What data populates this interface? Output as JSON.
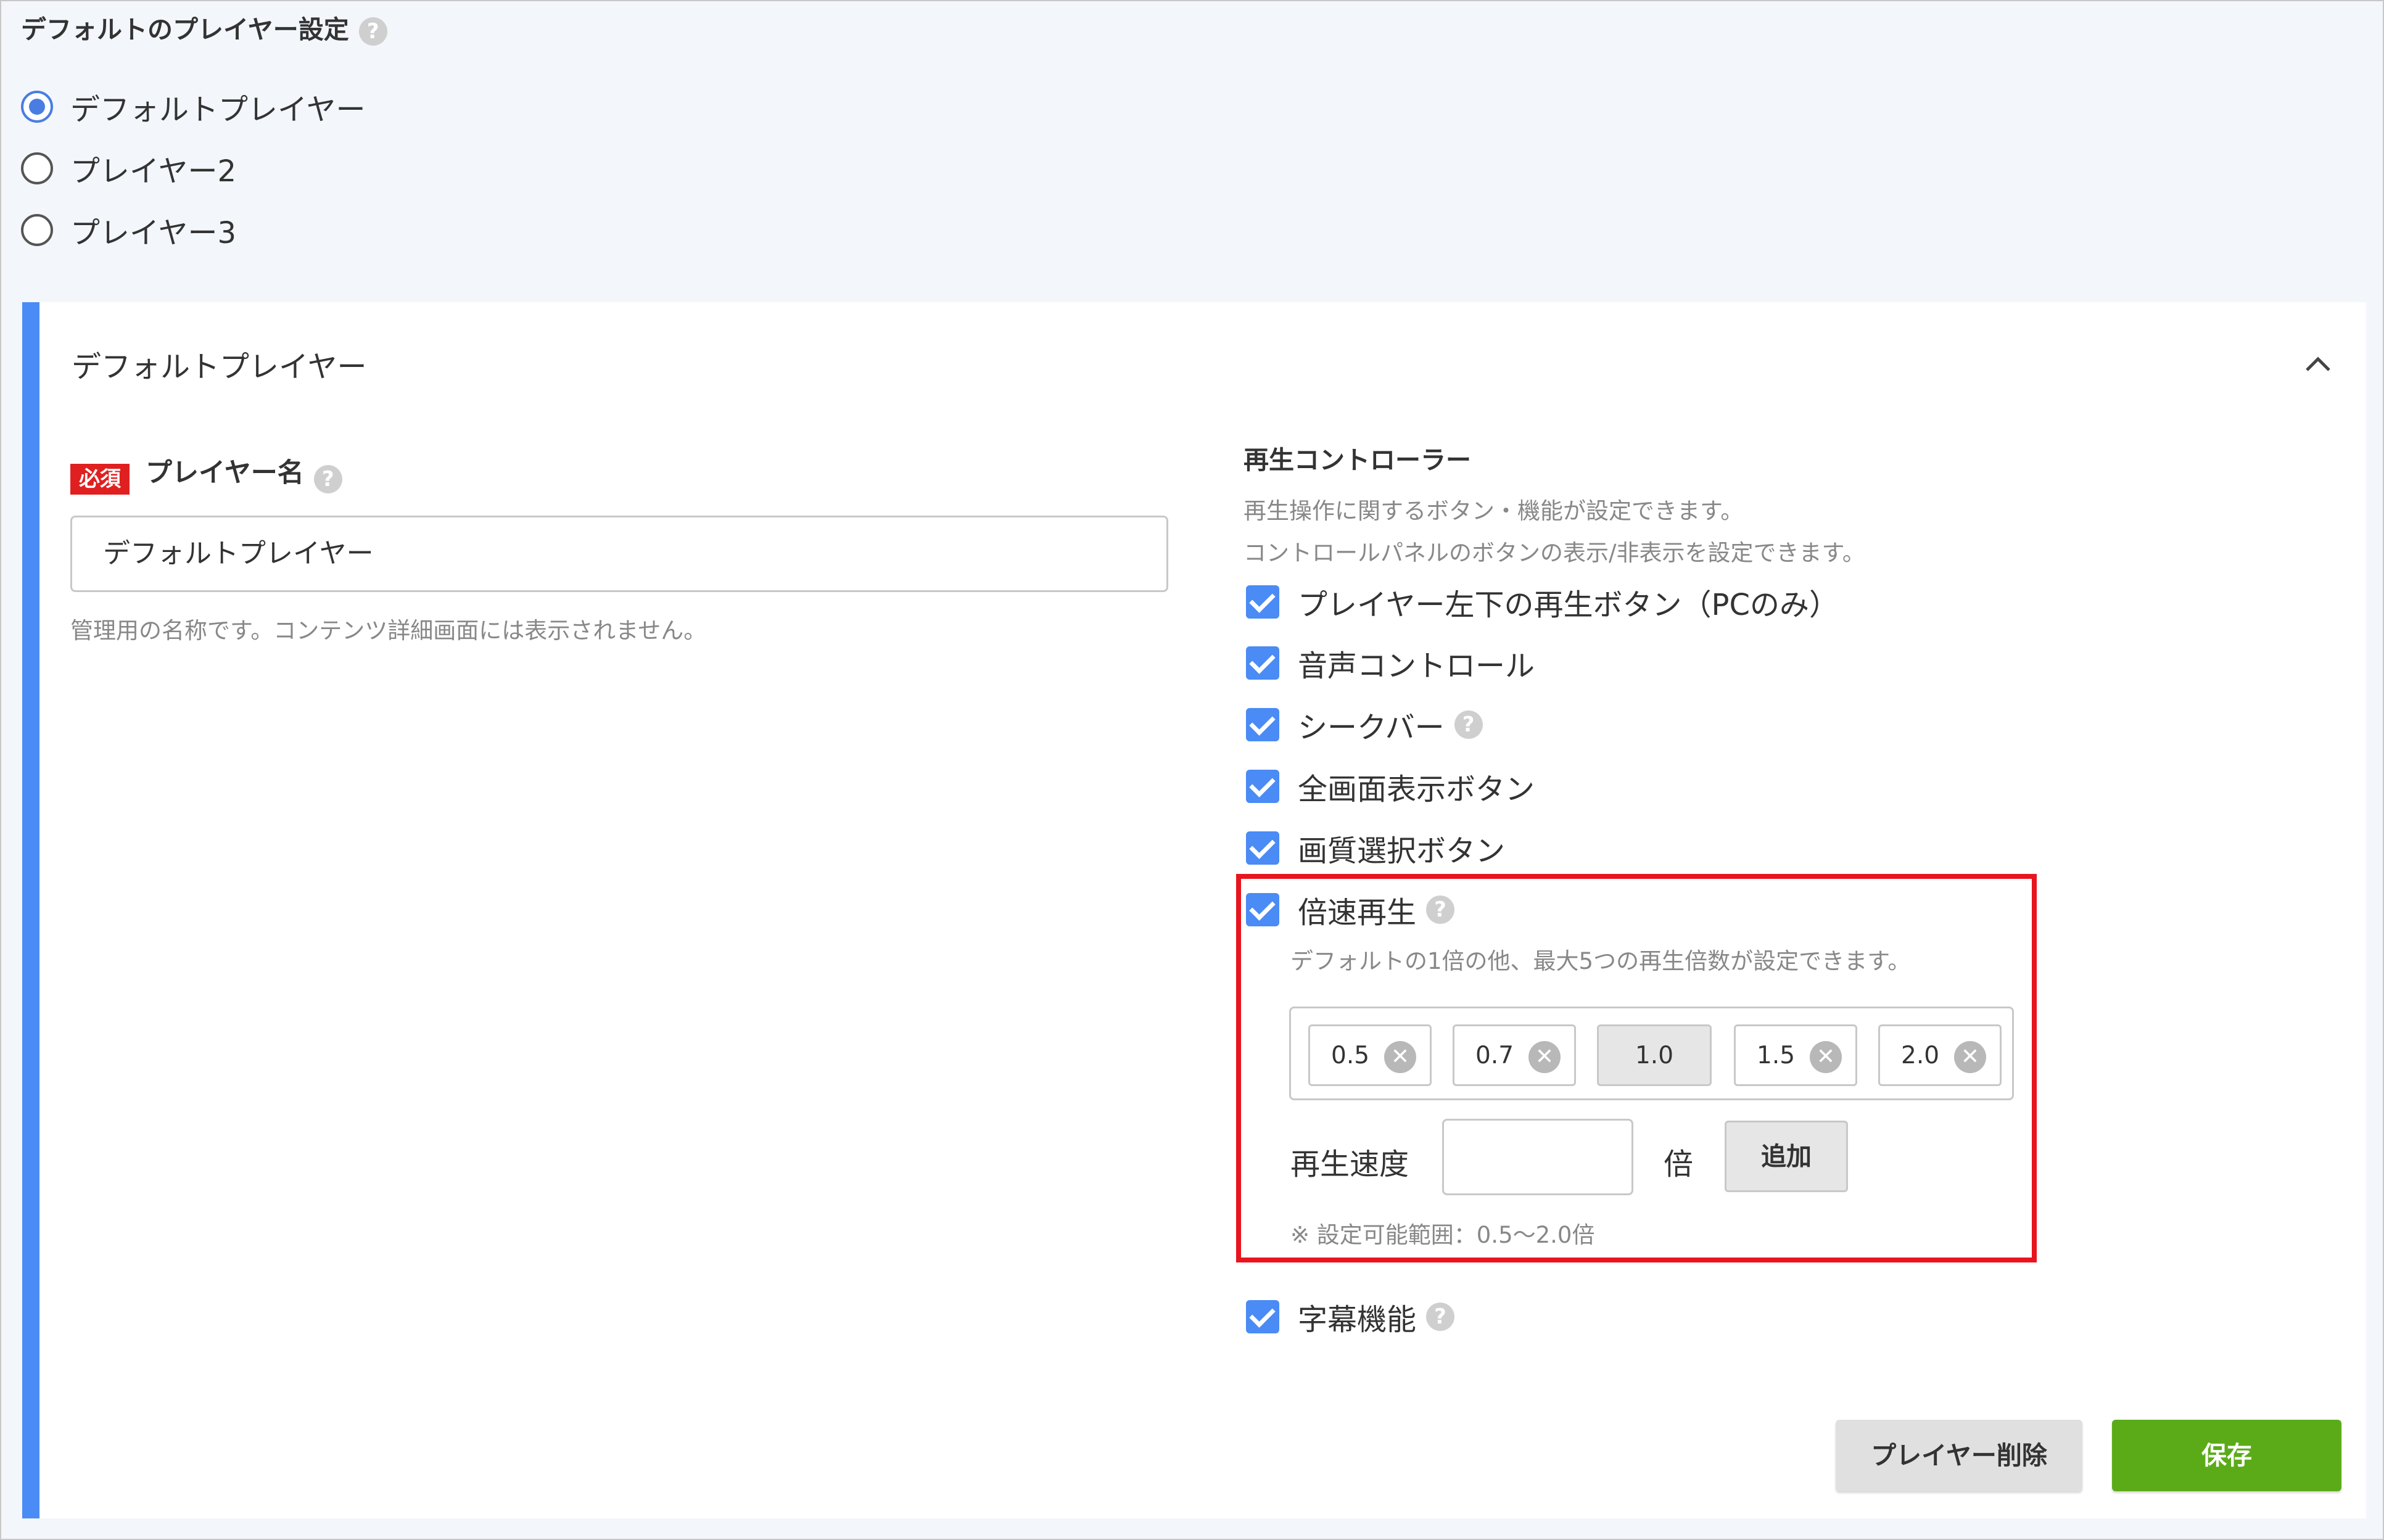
{
  "colors": {
    "accent_blue": "#4a8bf5",
    "required_red": "#e02020",
    "highlight_red": "#e8141e",
    "save_green": "#5bab18"
  },
  "player_settings": {
    "title": "デフォルトのプレイヤー設定",
    "help_symbol": "?",
    "options": [
      {
        "label": "デフォルトプレイヤー",
        "checked": true
      },
      {
        "label": "プレイヤー2",
        "checked": false
      },
      {
        "label": "プレイヤー3",
        "checked": false
      }
    ]
  },
  "panel": {
    "title": "デフォルトプレイヤー",
    "collapse_icon": "chevron-up-icon",
    "player_name": {
      "required_badge": "必須",
      "label": "プレイヤー名",
      "value": "デフォルトプレイヤー",
      "hint": "管理用の名称です。コンテンツ詳細画面には表示されません。"
    },
    "controller": {
      "title": "再生コントローラー",
      "desc1": "再生操作に関するボタン・機能が設定できます。",
      "desc2": "コントロールパネルのボタンの表示/非表示を設定できます。",
      "items": [
        {
          "label": "プレイヤー左下の再生ボタン（PCのみ）",
          "checked": true
        },
        {
          "label": "音声コントロール",
          "checked": true
        },
        {
          "label": "シークバー",
          "checked": true,
          "help": true
        },
        {
          "label": "全画面表示ボタン",
          "checked": true
        },
        {
          "label": "画質選択ボタン",
          "checked": true
        }
      ],
      "speed": {
        "label": "倍速再生",
        "checked": true,
        "desc": "デフォルトの1倍の他、最大5つの再生倍数が設定できます。",
        "chips": [
          {
            "value": "0.5",
            "removable": true
          },
          {
            "value": "0.7",
            "removable": true
          },
          {
            "value": "1.0",
            "removable": false
          },
          {
            "value": "1.5",
            "removable": true
          },
          {
            "value": "2.0",
            "removable": true
          }
        ],
        "remove_symbol": "✕",
        "input_label": "再生速度",
        "input_value": "",
        "unit": "倍",
        "add_label": "追加",
        "range_note": "※ 設定可能範囲：0.5〜2.0倍"
      },
      "subtitle": {
        "label": "字幕機能",
        "checked": true
      }
    },
    "actions": {
      "delete_label": "プレイヤー削除",
      "save_label": "保存"
    }
  }
}
